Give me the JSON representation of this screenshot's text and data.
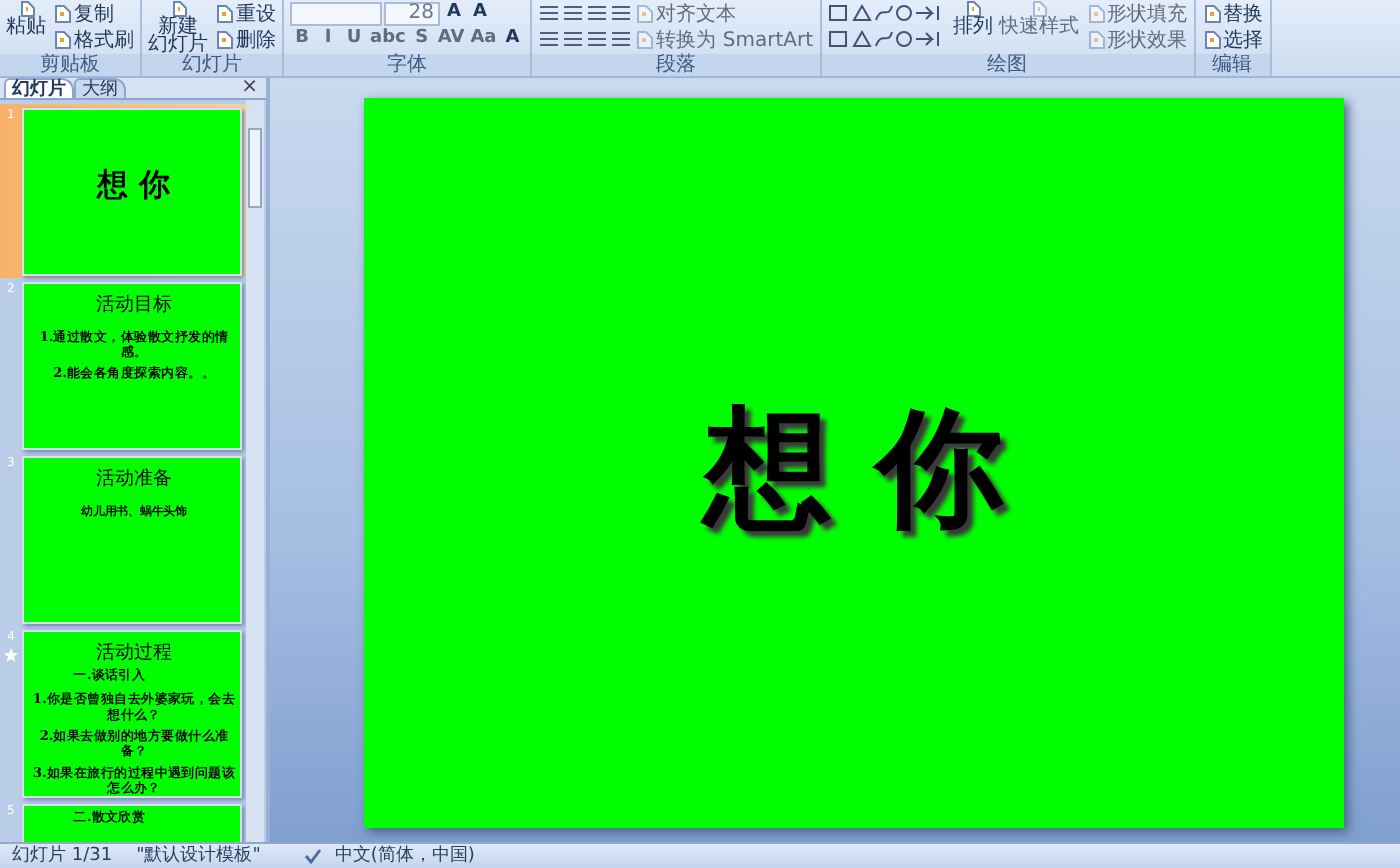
{
  "ribbon": {
    "groups": [
      {
        "label": "剪贴板",
        "columns": [
          {
            "kind": "large",
            "label_lines": [
              "粘贴"
            ],
            "disabled": false
          },
          {
            "kind": "stack",
            "lines": [
              {
                "controls": [
                  {
                    "kind": "small",
                    "label": "复制",
                    "disabled": false
                  }
                ]
              },
              {
                "controls": [
                  {
                    "kind": "small",
                    "label": "格式刷",
                    "disabled": false
                  }
                ]
              }
            ]
          }
        ]
      },
      {
        "label": "幻灯片",
        "columns": [
          {
            "kind": "large",
            "label_lines": [
              "新建",
              "幻灯片"
            ],
            "disabled": false
          },
          {
            "kind": "stack",
            "lines": [
              {
                "controls": [
                  {
                    "kind": "small",
                    "label": "重设",
                    "disabled": false
                  }
                ]
              },
              {
                "controls": [
                  {
                    "kind": "small",
                    "label": "删除",
                    "disabled": false
                  }
                ]
              }
            ]
          }
        ]
      },
      {
        "label": "字体",
        "columns": [
          {
            "kind": "stack",
            "lines": [
              {
                "controls": [
                  {
                    "kind": "field",
                    "disabled": false
                  },
                  {
                    "kind": "field",
                    "value": "28",
                    "disabled": false
                  },
                  {
                    "kind": "glyph",
                    "label": "A",
                    "disabled": false
                  },
                  {
                    "kind": "glyph",
                    "label": "A",
                    "disabled": false
                  }
                ]
              },
              {
                "controls": [
                  {
                    "kind": "glyph",
                    "label": "B",
                    "disabled": true
                  },
                  {
                    "kind": "glyph",
                    "label": "I",
                    "disabled": true
                  },
                  {
                    "kind": "glyph",
                    "label": "U",
                    "disabled": true
                  },
                  {
                    "kind": "glyph",
                    "label": "abc",
                    "disabled": true
                  },
                  {
                    "kind": "glyph",
                    "label": "S",
                    "disabled": true
                  },
                  {
                    "kind": "glyph",
                    "label": "AV",
                    "disabled": true
                  },
                  {
                    "kind": "glyph",
                    "label": "Aa",
                    "disabled": true
                  },
                  {
                    "kind": "glyph",
                    "label": "A",
                    "disabled": false
                  }
                ]
              }
            ]
          }
        ]
      },
      {
        "label": "段落",
        "columns": [
          {
            "kind": "stack",
            "lines": [
              {
                "controls": [
                  {
                    "kind": "icon",
                    "disabled": false
                  },
                  {
                    "kind": "icon",
                    "disabled": false
                  },
                  {
                    "kind": "icon",
                    "disabled": false
                  },
                  {
                    "kind": "icon",
                    "disabled": false
                  },
                  {
                    "kind": "small",
                    "label": "对齐文本",
                    "disabled": true
                  }
                ]
              },
              {
                "controls": [
                  {
                    "kind": "icon",
                    "disabled": false
                  },
                  {
                    "kind": "icon",
                    "disabled": false
                  },
                  {
                    "kind": "icon",
                    "disabled": false
                  },
                  {
                    "kind": "icon",
                    "disabled": false
                  },
                  {
                    "kind": "small",
                    "label": "转换为 SmartArt",
                    "disabled": true
                  }
                ]
              }
            ]
          }
        ]
      },
      {
        "label": "绘图",
        "columns": [
          {
            "kind": "stack",
            "lines": [
              {
                "controls": [
                  {
                    "kind": "gallery",
                    "disabled": false
                  }
                ]
              },
              {
                "controls": [
                  {
                    "kind": "gallery",
                    "disabled": false
                  }
                ]
              }
            ]
          },
          {
            "kind": "large",
            "label_lines": [
              "排列"
            ],
            "disabled": false
          },
          {
            "kind": "large",
            "label_lines": [
              "快速样式"
            ],
            "disabled": true
          },
          {
            "kind": "stack",
            "lines": [
              {
                "controls": [
                  {
                    "kind": "small",
                    "label": "形状填充",
                    "disabled": true
                  }
                ]
              },
              {
                "controls": [
                  {
                    "kind": "small",
                    "label": "形状效果",
                    "disabled": true
                  }
                ]
              }
            ]
          }
        ]
      },
      {
        "label": "编辑",
        "columns": [
          {
            "kind": "stack",
            "lines": [
              {
                "controls": [
                  {
                    "kind": "small",
                    "label": "替换",
                    "disabled": false
                  }
                ]
              },
              {
                "controls": [
                  {
                    "kind": "small",
                    "label": "选择",
                    "disabled": false
                  }
                ]
              }
            ]
          }
        ]
      }
    ]
  },
  "panel": {
    "tabs": [
      {
        "label": "幻灯片",
        "selected": true
      },
      {
        "label": "大纲",
        "selected": false
      }
    ],
    "close": "×",
    "slides": [
      {
        "number": "1",
        "selected": true,
        "animated": false,
        "items": [
          {
            "kind": "cover",
            "text": "想 你"
          }
        ]
      },
      {
        "number": "2",
        "selected": false,
        "animated": false,
        "items": [
          {
            "kind": "title",
            "text": "活动目标"
          },
          {
            "kind": "line",
            "text": "1.通过散文，体验散文抒发的情感。"
          },
          {
            "kind": "line",
            "text": "2.能会各角度探索内容。。"
          }
        ]
      },
      {
        "number": "3",
        "selected": false,
        "animated": false,
        "items": [
          {
            "kind": "title",
            "text": "活动准备"
          },
          {
            "kind": "subtitle",
            "text": "幼儿用书、蜗牛头饰"
          }
        ]
      },
      {
        "number": "4",
        "selected": false,
        "animated": true,
        "items": [
          {
            "kind": "title",
            "text": "活动过程"
          },
          {
            "kind": "heading",
            "text": "一.谈话引入"
          },
          {
            "kind": "line",
            "text": "1.你是否曾独自去外婆家玩，会去想什么？"
          },
          {
            "kind": "line",
            "text": "2.如果去做别的地方要做什么准备？"
          },
          {
            "kind": "line",
            "text": "3.如果在旅行的过程中遇到问题该怎么办？"
          }
        ]
      },
      {
        "number": "5",
        "selected": false,
        "animated": false,
        "items": [
          {
            "kind": "heading",
            "text": "二.散文欣赏"
          }
        ]
      }
    ]
  },
  "main_slide": {
    "title": "想 你"
  },
  "status_bar": {
    "slide": "幻灯片 1/31",
    "theme": "\"默认设计模板\"",
    "language": "中文(简体，中国)"
  }
}
